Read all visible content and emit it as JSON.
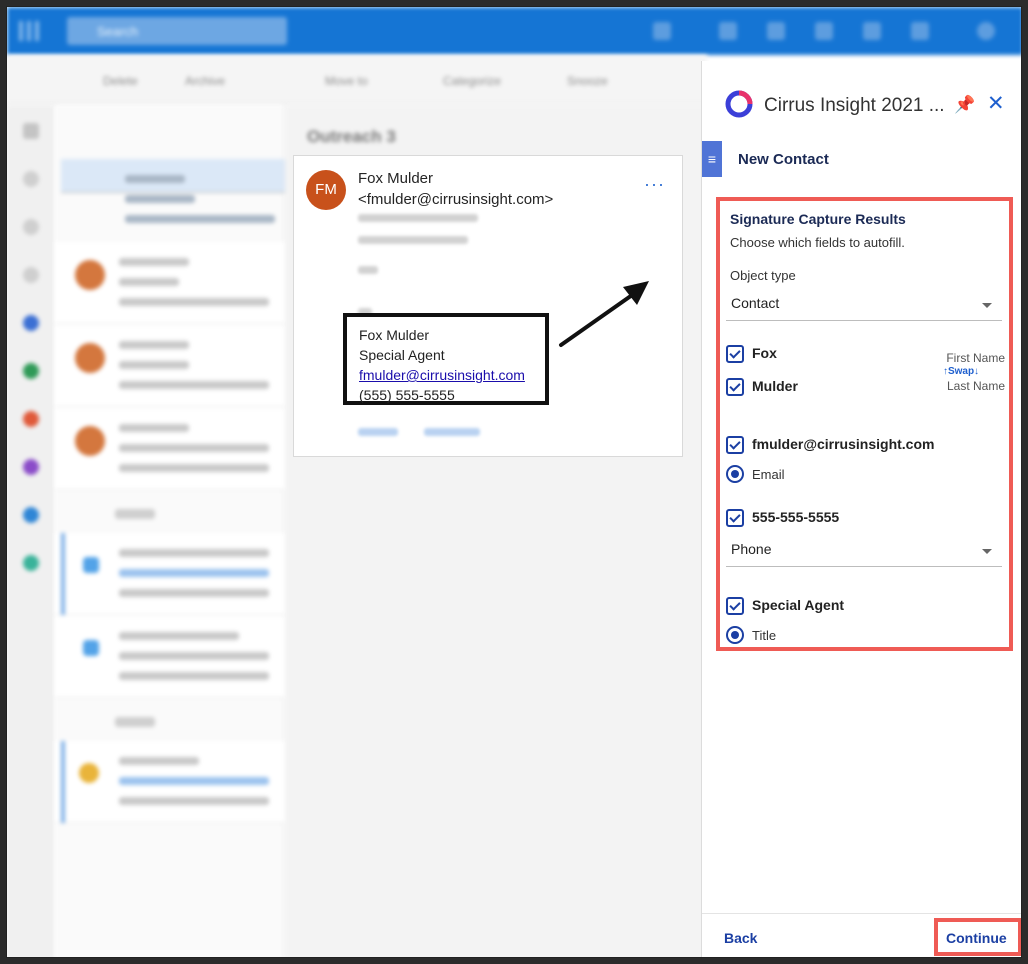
{
  "outlook": {
    "search_placeholder": "Search",
    "toolbar": [
      "Delete",
      "Archive",
      "Move to",
      "Categorize",
      "Snooze"
    ],
    "folder_title": "Outreach 3",
    "section_last_week": "Last week",
    "section_older": "Older"
  },
  "email": {
    "avatar_initials": "FM",
    "from_name": "Fox Mulder",
    "from_email": "<fmulder@cirrusinsight.com>",
    "more_label": "···",
    "signature": {
      "name": "Fox Mulder",
      "title": "Special Agent",
      "email": "fmulder@cirrusinsight.com",
      "phone": "(555) 555-5555"
    }
  },
  "panel": {
    "title": "Cirrus Insight 2021 ...",
    "tab_title": "New Contact",
    "results_heading": "Signature Capture Results",
    "results_sub": "Choose which fields to autofill.",
    "object_type_label": "Object type",
    "object_type_value": "Contact",
    "first_value": "Fox",
    "last_value": "Mulder",
    "first_name_label": "First Name",
    "swap_label": "↑Swap↓",
    "last_name_label": "Last Name",
    "email_value": "fmulder@cirrusinsight.com",
    "email_radio_label": "Email",
    "phone_value": "555-555-5555",
    "phone_type_value": "Phone",
    "title_value": "Special Agent",
    "title_radio_label": "Title",
    "back_label": "Back",
    "continue_label": "Continue"
  },
  "colors": {
    "outlook_blue": "#1575d4",
    "highlight_red": "#ef5b55",
    "accent_navy": "#1b3fa3",
    "avatar_orange": "#c8511b"
  }
}
